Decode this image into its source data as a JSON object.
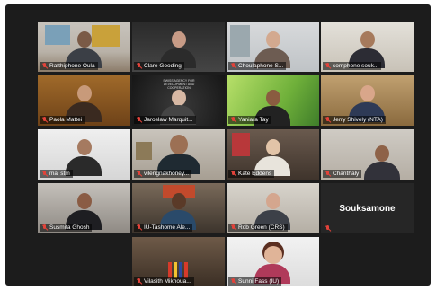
{
  "participants": [
    {
      "name": "Ratthiphone Oula"
    },
    {
      "name": "Clare Gooding"
    },
    {
      "name": "Choulaphone S..."
    },
    {
      "name": "somphone souk..."
    },
    {
      "name": "Paola Mattei"
    },
    {
      "name": "Jaroslaw Marquit...",
      "logo_text": "SWISS AGENCY FOR DEVELOPMENT AND COOPERATION"
    },
    {
      "name": "Yaniara Tay"
    },
    {
      "name": "Jerry Shively (NTA)"
    },
    {
      "name": "mal stm"
    },
    {
      "name": "vilengnakhoney..."
    },
    {
      "name": "Kate Eddens"
    },
    {
      "name": "Chanthaly"
    },
    {
      "name": "Susmita Ghosh"
    },
    {
      "name": "IU-Tashome Ale..."
    },
    {
      "name": "Rob Green (CRS)"
    },
    {
      "name": "Souksamone",
      "tile_label": "Souksamone"
    },
    {
      "name": "Vilasith Mikhoua..."
    },
    {
      "name": "Sunni Fass (IU)"
    }
  ],
  "colors": {
    "background": "#1c1c1c",
    "active_speaker_border": "#d6e34a",
    "muted_icon": "#e2433a"
  },
  "icons": {
    "muted": "mic-muted-icon"
  }
}
